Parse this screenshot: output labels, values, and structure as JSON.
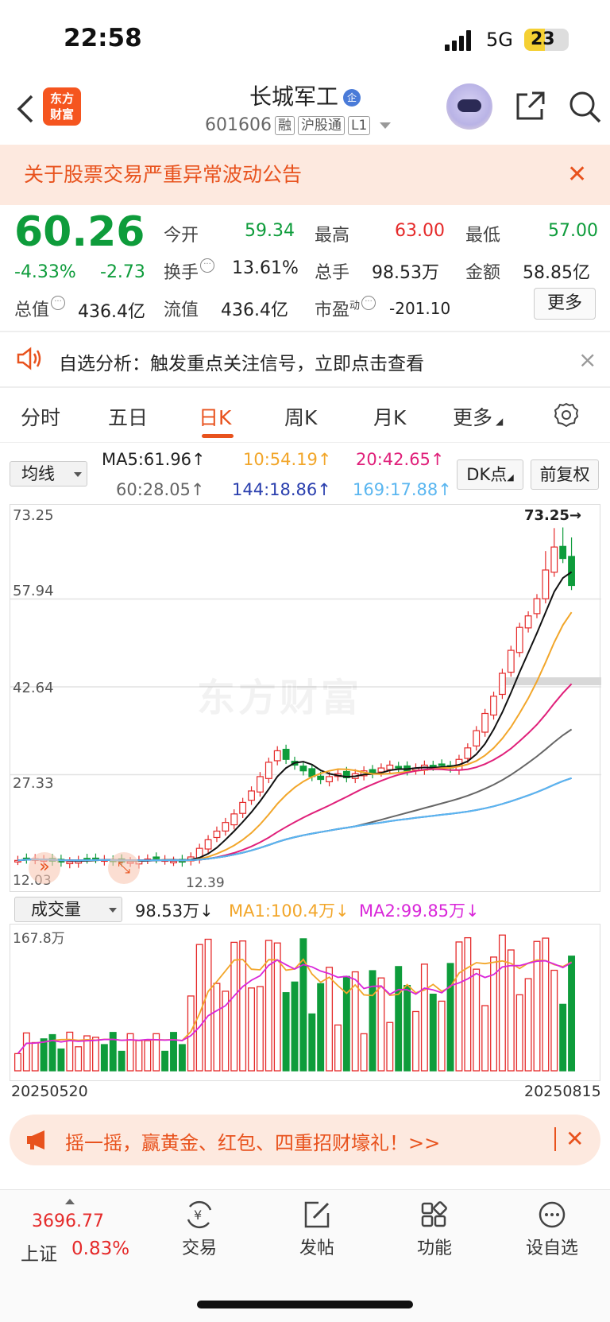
{
  "status_bar": {
    "time": "22:58",
    "network": "5G",
    "battery": "23"
  },
  "header": {
    "logo_text": [
      "东方",
      "财富"
    ],
    "title": "长城军工",
    "title_badge": "企",
    "code": "601606",
    "tags": [
      "融",
      "沪股通",
      "L1"
    ]
  },
  "notice": {
    "text": "关于股票交易严重异常波动公告",
    "close": "✕"
  },
  "quote": {
    "price": "60.26",
    "change_pct": "-4.33%",
    "change": "-2.73",
    "open_label": "今开",
    "open": "59.34",
    "high_label": "最高",
    "high": "63.00",
    "low_label": "最低",
    "low": "57.00",
    "turnover_label": "换手",
    "turnover": "13.61%",
    "volume_label": "总手",
    "volume": "98.53万",
    "amount_label": "金额",
    "amount": "58.85亿",
    "mktcap_label": "总值",
    "mktcap": "436.4亿",
    "float_label": "流值",
    "float": "436.4亿",
    "pe_label": "市盈",
    "pe_sup": "动",
    "pe": "-201.10",
    "more": "更多"
  },
  "analysis": {
    "text": "自选分析：触发重点关注信号，立即点击查看",
    "close": "×"
  },
  "tabs": [
    "分时",
    "五日",
    "日K",
    "周K",
    "月K",
    "更多"
  ],
  "ma_bar": {
    "select": "均线",
    "ma5": "MA5:61.96↑",
    "ma10": "10:54.19↑",
    "ma20": "20:42.65↑",
    "ma60": "60:28.05↑",
    "ma144": "144:18.86↑",
    "ma169": "169:17.88↑",
    "dk": "DK点",
    "fq": "前复权"
  },
  "chart_labels": {
    "y_ticks": [
      "73.25",
      "57.94",
      "42.64",
      "27.33"
    ],
    "low_label": "12.03",
    "low_label2": "12.39",
    "peak_label": "73.25→",
    "watermark": "东方财富"
  },
  "volume_bar": {
    "select": "成交量",
    "vol": "98.53万↓",
    "ma1": "MA1:100.4万↓",
    "ma2": "MA2:99.85万↓",
    "max_label": "167.8万",
    "date_start": "20250520",
    "date_end": "20250815"
  },
  "chart_data": {
    "type": "candlestick",
    "title": "",
    "ylim": [
      12.03,
      73.25
    ],
    "series": [
      {
        "name": "MA5",
        "values": [
          61.96
        ]
      },
      {
        "name": "MA10",
        "values": [
          54.19
        ]
      },
      {
        "name": "MA20",
        "values": [
          42.65
        ]
      },
      {
        "name": "MA60",
        "values": [
          28.05
        ]
      },
      {
        "name": "MA144",
        "values": [
          18.86
        ]
      },
      {
        "name": "MA169",
        "values": [
          17.88
        ]
      }
    ],
    "x_range": [
      "20250520",
      "20250815"
    ],
    "volume_max": "167.8万"
  },
  "promo": {
    "text": "摇一摇，赢黄金、红包、四重招财壕礼！>>",
    "close": "✕"
  },
  "bottom_nav": {
    "index_value": "3696.77",
    "index_name": "上证",
    "index_pct": "0.83%",
    "items": [
      "交易",
      "发帖",
      "功能",
      "设自选"
    ]
  },
  "colors": {
    "up": "#e52a2a",
    "down": "#0e9c3b",
    "accent": "#e8521d"
  }
}
